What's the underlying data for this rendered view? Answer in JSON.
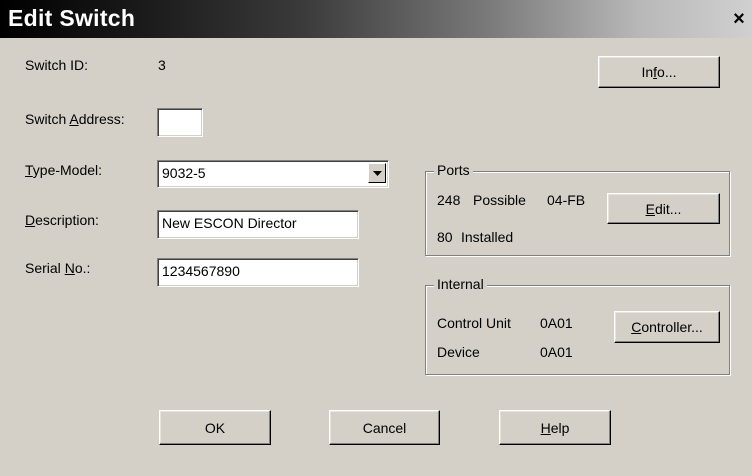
{
  "window": {
    "title": "Edit Switch",
    "close_glyph": "×"
  },
  "fields": {
    "switch_id": {
      "label": "Switch ID:",
      "value": "3"
    },
    "switch_address": {
      "label_pre": "Switch ",
      "label_u": "A",
      "label_post": "ddress:",
      "value": ""
    },
    "type_model": {
      "label_pre": "",
      "label_u": "T",
      "label_post": "ype-Model:",
      "value": "9032-5"
    },
    "description": {
      "label_pre": "",
      "label_u": "D",
      "label_post": "escription:",
      "value": "New ESCON Director"
    },
    "serial_no": {
      "label_pre": "Serial ",
      "label_u": "N",
      "label_post": "o.:",
      "value": "1234567890"
    }
  },
  "info_button": {
    "pre": "In",
    "u": "f",
    "post": "o..."
  },
  "ports": {
    "legend": "Ports",
    "possible_count": "248",
    "possible_label": "Possible",
    "range": "04-FB",
    "installed_count": "80",
    "installed_label": "Installed",
    "edit_button": {
      "pre": "",
      "u": "E",
      "post": "dit..."
    }
  },
  "internal": {
    "legend": "Internal",
    "control_unit_label": "Control Unit",
    "control_unit_value": "0A01",
    "device_label": "Device",
    "device_value": "0A01",
    "controller_button": {
      "pre": "",
      "u": "C",
      "post": "ontroller..."
    }
  },
  "buttons": {
    "ok": "OK",
    "cancel": "Cancel",
    "help": {
      "pre": "",
      "u": "H",
      "post": "elp"
    }
  }
}
